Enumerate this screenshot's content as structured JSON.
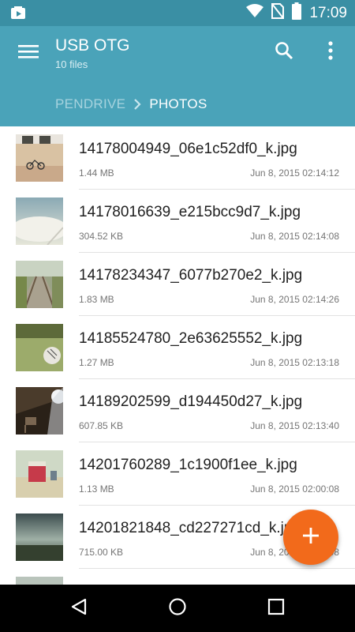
{
  "status_bar": {
    "time": "17:09",
    "icons": [
      "notification-icon",
      "wifi-icon",
      "no-sim-icon",
      "battery-icon"
    ]
  },
  "app_bar": {
    "title": "USB OTG",
    "subtitle": "10 files",
    "icons": [
      "menu-icon",
      "search-icon",
      "more-vert-icon"
    ],
    "color": "#4aa3b9"
  },
  "breadcrumb": {
    "items": [
      "PENDRIVE",
      "PHOTOS"
    ],
    "separator_icon": "chevron-right-icon"
  },
  "files": [
    {
      "name": "14178004949_06e1c52df0_k.jpg",
      "size": "1.44 MB",
      "date": "Jun 8, 2015 02:14:12"
    },
    {
      "name": "14178016639_e215bcc9d7_k.jpg",
      "size": "304.52 KB",
      "date": "Jun 8, 2015 02:14:08"
    },
    {
      "name": "14178234347_6077b270e2_k.jpg",
      "size": "1.83 MB",
      "date": "Jun 8, 2015 02:14:26"
    },
    {
      "name": "14185524780_2e63625552_k.jpg",
      "size": "1.27 MB",
      "date": "Jun 8, 2015 02:13:18"
    },
    {
      "name": "14189202599_d194450d27_k.jpg",
      "size": "607.85 KB",
      "date": "Jun 8, 2015 02:13:40"
    },
    {
      "name": "14201760289_1c1900f1ee_k.jpg",
      "size": "1.13 MB",
      "date": "Jun 8, 2015 02:00:08"
    },
    {
      "name": "14201821848_cd227271cd_k.jpg",
      "size": "715.00 KB",
      "date": "Jun 8, 2015 02:14:08"
    }
  ],
  "fab": {
    "icon": "add-icon",
    "color": "#f26a1b"
  },
  "nav_bar": {
    "icons": [
      "back-icon",
      "home-icon",
      "recents-icon"
    ]
  }
}
